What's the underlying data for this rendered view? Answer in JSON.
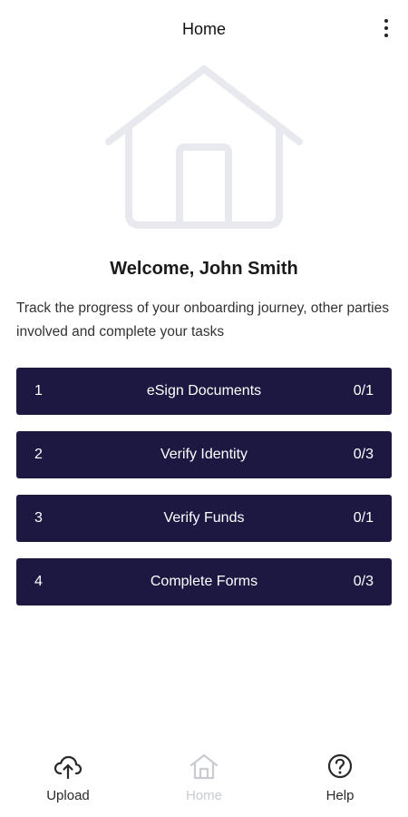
{
  "header": {
    "title": "Home",
    "menu_icon": "more-vertical-icon"
  },
  "hero": {
    "icon": "house-icon",
    "color": "#e8e9ee"
  },
  "welcome": {
    "title": "Welcome, John Smith",
    "description": "Track the progress of your onboarding journey, other parties involved and complete your tasks"
  },
  "tasks": [
    {
      "number": "1",
      "name": "eSign Documents",
      "count": "0/1"
    },
    {
      "number": "2",
      "name": "Verify Identity",
      "count": "0/3"
    },
    {
      "number": "3",
      "name": "Verify Funds",
      "count": "0/1"
    },
    {
      "number": "4",
      "name": "Complete Forms",
      "count": "0/3"
    }
  ],
  "bottom_nav": {
    "items": [
      {
        "label": "Upload",
        "icon": "upload-cloud-icon",
        "active": false
      },
      {
        "label": "Home",
        "icon": "home-icon",
        "active": true
      },
      {
        "label": "Help",
        "icon": "help-circle-icon",
        "active": false
      }
    ]
  },
  "colors": {
    "task_background": "#1c1842",
    "task_text": "#ffffff",
    "nav_inactive": "#2a2a2a",
    "nav_active": "#c9cbd3"
  }
}
